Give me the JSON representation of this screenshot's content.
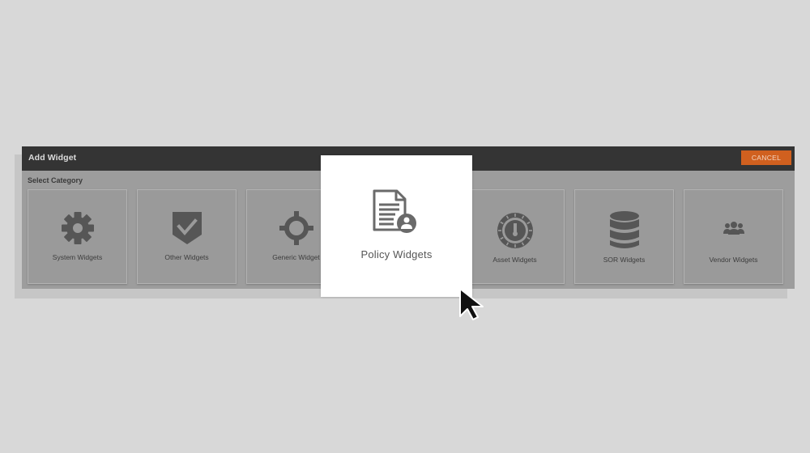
{
  "dialog": {
    "title": "Add Widget",
    "cancel_label": "CANCEL",
    "section_label": "Select Category"
  },
  "categories": [
    {
      "label": "System Widgets",
      "icon": "gear-icon"
    },
    {
      "label": "Other Widgets",
      "icon": "shield-check-icon"
    },
    {
      "label": "Generic Widget",
      "icon": "crosshair-icon"
    },
    {
      "label": "Asset Widgets",
      "icon": "dial-icon"
    },
    {
      "label": "SOR Widgets",
      "icon": "database-icon"
    },
    {
      "label": "Vendor Widgets",
      "icon": "users-icon"
    }
  ],
  "highlighted": {
    "label": "Policy Widgets",
    "icon": "policy-document-icon"
  },
  "colors": {
    "header": "#343434",
    "cancel": "#d0601f",
    "dialog_body": "#9d9d9d",
    "highlight_bg": "#ffffff"
  }
}
